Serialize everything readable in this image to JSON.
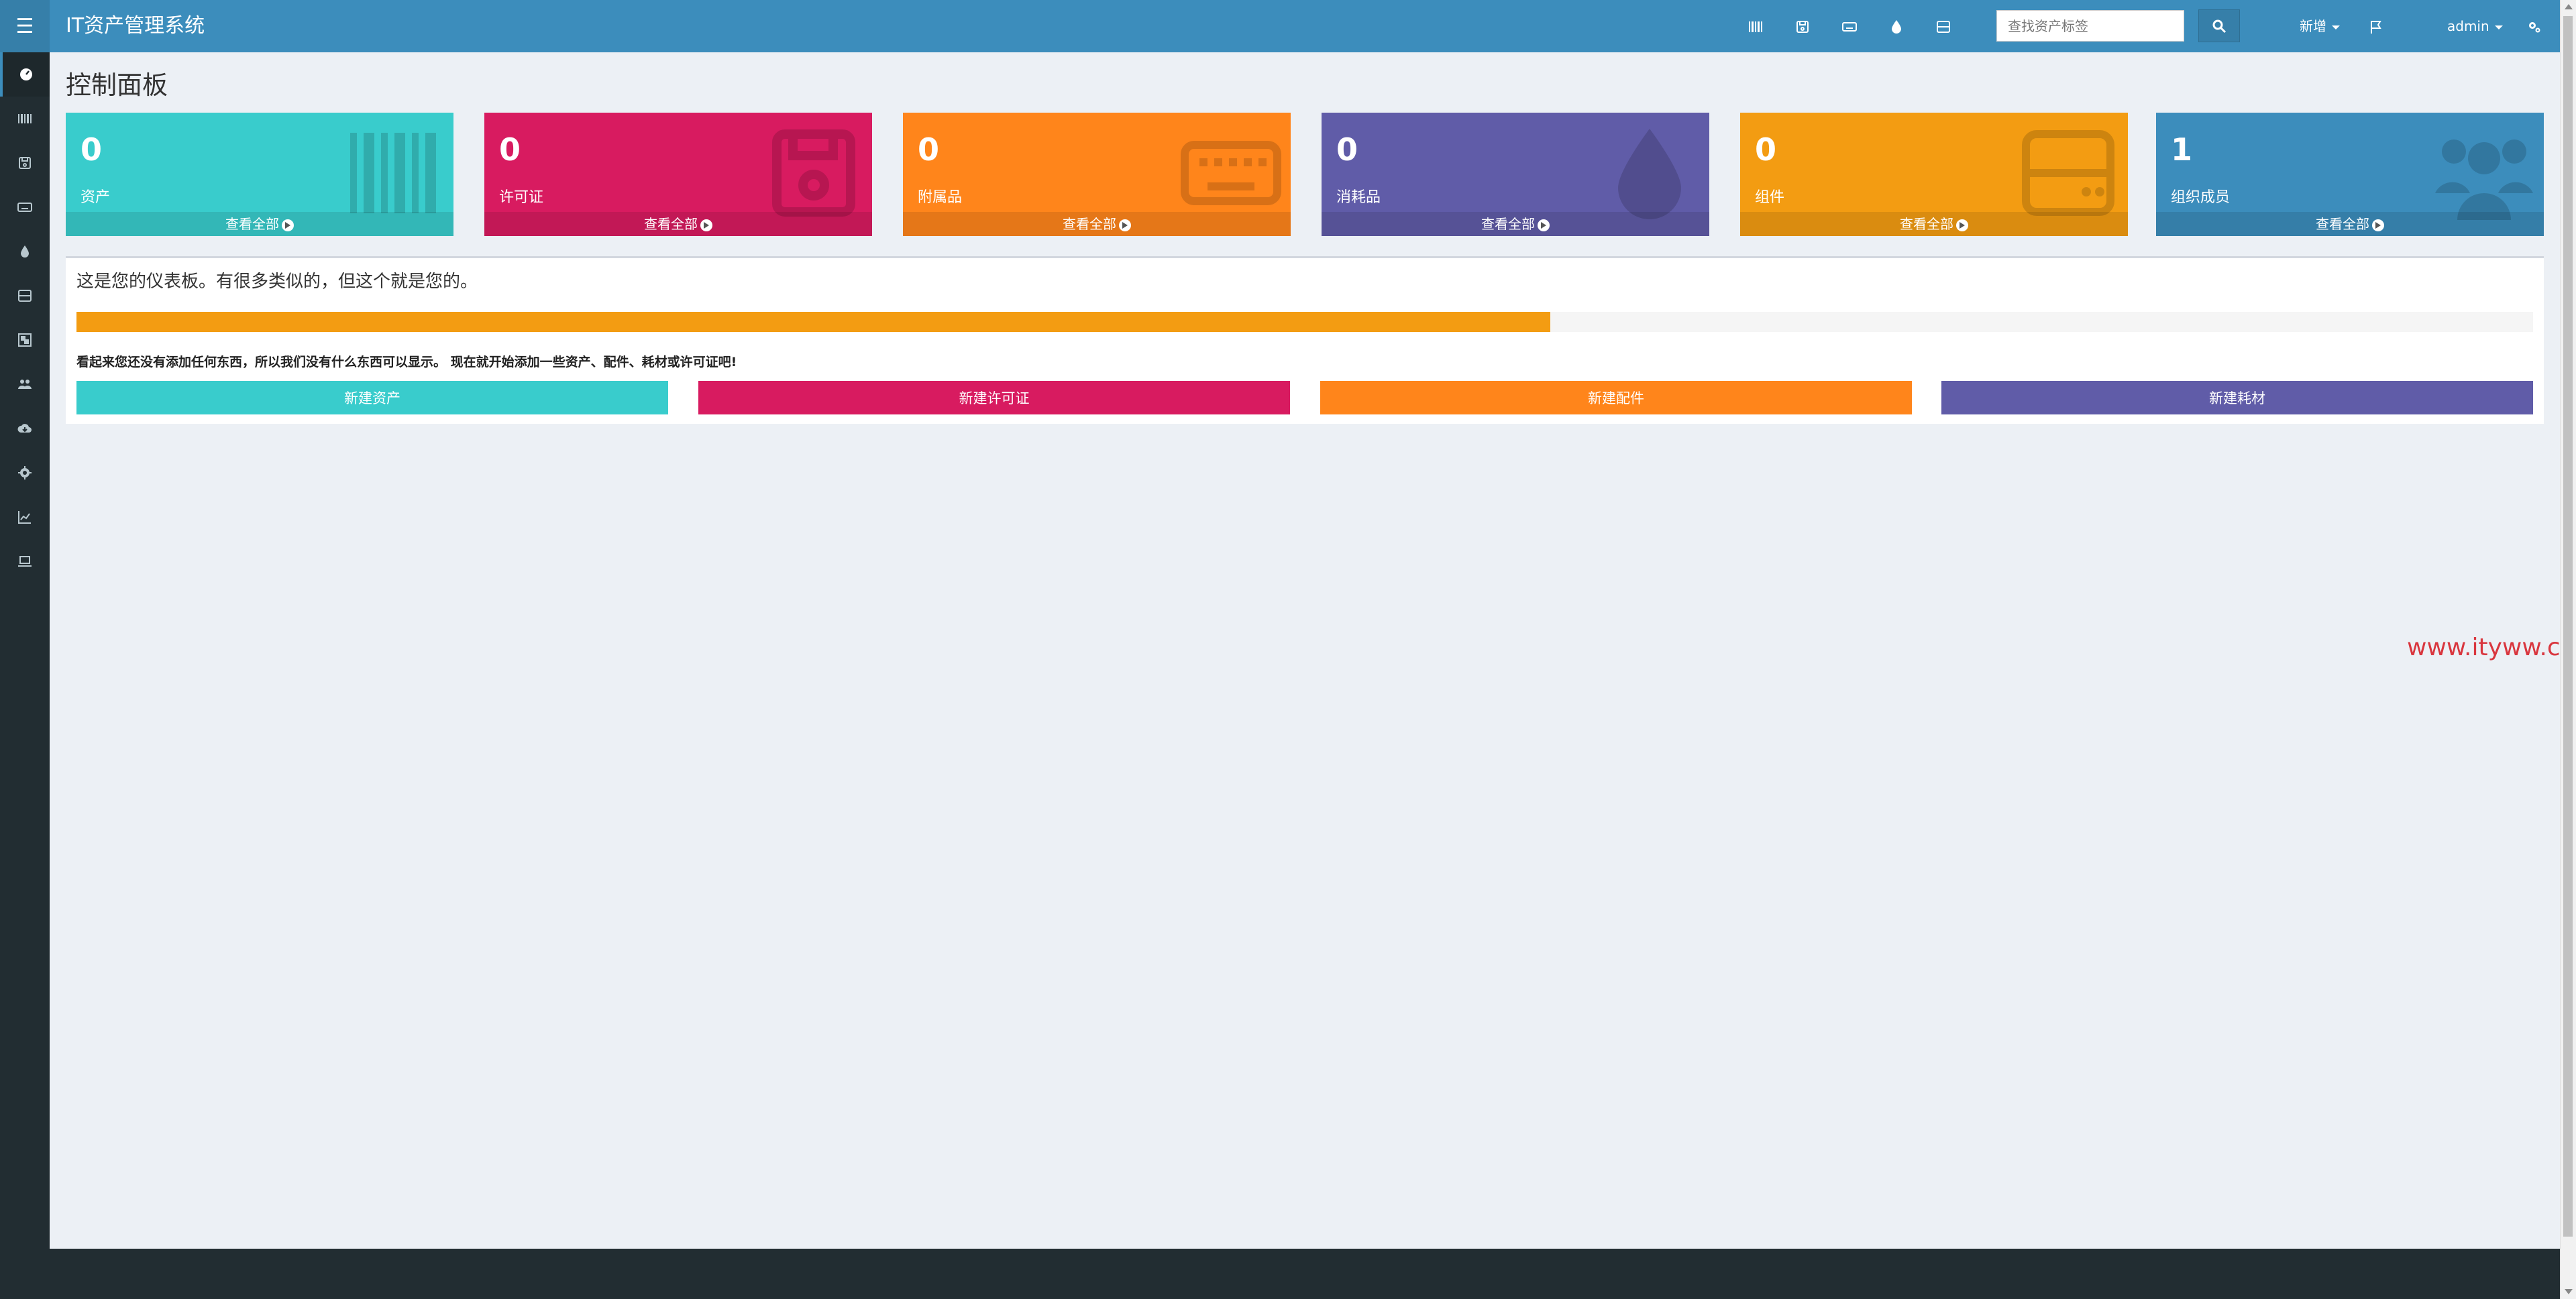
{
  "app": {
    "title": "IT资产管理系统",
    "menu_icon": "hamburger-icon"
  },
  "topbar": {
    "icons": [
      "barcode-icon",
      "floppy-disk-icon",
      "keyboard-icon",
      "tint-drop-icon",
      "hdd-icon"
    ],
    "search": {
      "placeholder": "查找资产标签",
      "value": "",
      "button_icon": "search-icon"
    },
    "new_menu": "新增",
    "flag_icon": "flag-icon",
    "user_menu": "admin",
    "settings_icon": "cogs-icon"
  },
  "sidebar": {
    "items": [
      {
        "icon": "dashboard-icon",
        "active": true
      },
      {
        "icon": "barcode-icon",
        "active": false
      },
      {
        "icon": "floppy-disk-icon",
        "active": false
      },
      {
        "icon": "keyboard-icon",
        "active": false
      },
      {
        "icon": "tint-drop-icon",
        "active": false
      },
      {
        "icon": "hdd-icon",
        "active": false
      },
      {
        "icon": "object-group-icon",
        "active": false
      },
      {
        "icon": "users-icon",
        "active": false
      },
      {
        "icon": "cloud-download-icon",
        "active": false
      },
      {
        "icon": "cog-icon",
        "active": false
      },
      {
        "icon": "area-chart-icon",
        "active": false
      },
      {
        "icon": "laptop-icon",
        "active": false
      }
    ]
  },
  "page": {
    "title": "控制面板"
  },
  "stat_boxes": [
    {
      "count": "0",
      "label": "资产",
      "link": "查看全部",
      "color": "#39cccc",
      "icon": "barcode-icon"
    },
    {
      "count": "0",
      "label": "许可证",
      "link": "查看全部",
      "color": "#d81b60",
      "icon": "floppy-disk-icon"
    },
    {
      "count": "0",
      "label": "附属品",
      "link": "查看全部",
      "color": "#ff851b",
      "icon": "keyboard-icon"
    },
    {
      "count": "0",
      "label": "消耗品",
      "link": "查看全部",
      "color": "#605ca8",
      "icon": "tint-drop-icon"
    },
    {
      "count": "0",
      "label": "组件",
      "link": "查看全部",
      "color": "#f39c12",
      "icon": "hdd-icon"
    },
    {
      "count": "1",
      "label": "组织成员",
      "link": "查看全部",
      "color": "#3c8dbc",
      "icon": "users-icon"
    }
  ],
  "dashboard_panel": {
    "title": "这是您的仪表板。有很多类似的，但这个就是您的。",
    "progress_fraction": 0.6,
    "notice": "看起来您还没有添加任何东西，所以我们没有什么东西可以显示。 现在就开始添加一些资产、配件、耗材或许可证吧!",
    "buttons": [
      {
        "label": "新建资产",
        "color": "#39cccc"
      },
      {
        "label": "新建许可证",
        "color": "#d81b60"
      },
      {
        "label": "新建配件",
        "color": "#ff851b"
      },
      {
        "label": "新建耗材",
        "color": "#605ca8"
      }
    ]
  },
  "watermark": "www.ityww.cn"
}
